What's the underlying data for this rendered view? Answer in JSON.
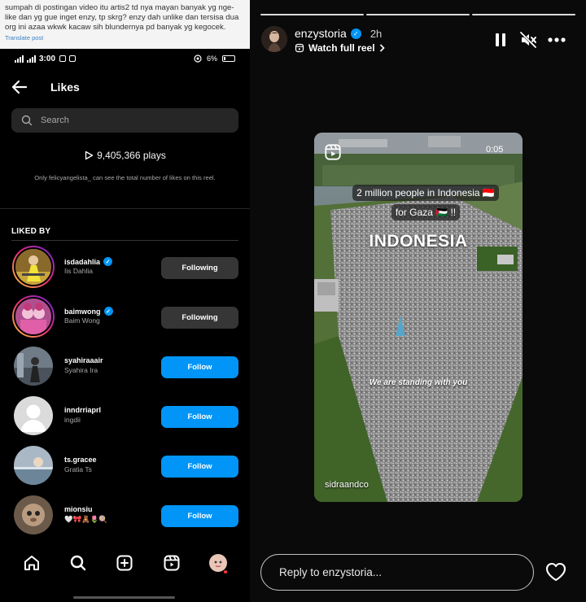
{
  "tweet": {
    "text": "sumpah di postingan video itu artis2 td nya mayan banyak yg nge-like dan yg gue inget enzy, tp skrg? enzy dah unlike dan tersisa dua org ini azaa wkwk kacaw sih blundernya pd banyak yg kegocek.",
    "translate_label": "Translate post"
  },
  "statusbar": {
    "time": "3:00",
    "battery": "6%"
  },
  "likes_page": {
    "title": "Likes",
    "search_placeholder": "Search",
    "plays": "9,405,366 plays",
    "note": "Only felicyangelista_ can see the total number of likes on this reel.",
    "section_label": "LIKED BY",
    "users": [
      {
        "username": "isdadahlia",
        "name": "Iis Dahlia",
        "verified": true,
        "button": "Following",
        "story_ring": true
      },
      {
        "username": "baimwong",
        "name": "Baim Wong",
        "verified": true,
        "button": "Following",
        "story_ring": true
      },
      {
        "username": "syahiraaair",
        "name": "Syahira Ira",
        "verified": false,
        "button": "Follow",
        "story_ring": false
      },
      {
        "username": "inndrriaprl",
        "name": "ingdii",
        "verified": false,
        "button": "Follow",
        "story_ring": false
      },
      {
        "username": "ts.gracee",
        "name": "Gratia Ts",
        "verified": false,
        "button": "Follow",
        "story_ring": false
      },
      {
        "username": "mionsiu",
        "name": "🤍🎀🧸🌷🍭",
        "verified": false,
        "button": "Follow",
        "story_ring": false
      }
    ],
    "nav_icons": [
      "home-icon",
      "search-icon",
      "create-icon",
      "reels-icon",
      "profile-avatar"
    ]
  },
  "story": {
    "username": "enzystoria",
    "verified": true,
    "time_ago": "2h",
    "watch_full_label": "Watch full reel",
    "reel": {
      "timer": "0:05",
      "caption": "2 million people in Indonesia 🇮🇩 for Gaza 🇵🇸 !!",
      "headline": "INDONESIA",
      "subtitle": "We are standing with you",
      "credit": "sidraandco"
    },
    "reply_placeholder": "Reply to enzystoria..."
  },
  "colors": {
    "follow_blue": "#0095f6",
    "following_gray": "#363636",
    "search_bg": "#262626"
  }
}
